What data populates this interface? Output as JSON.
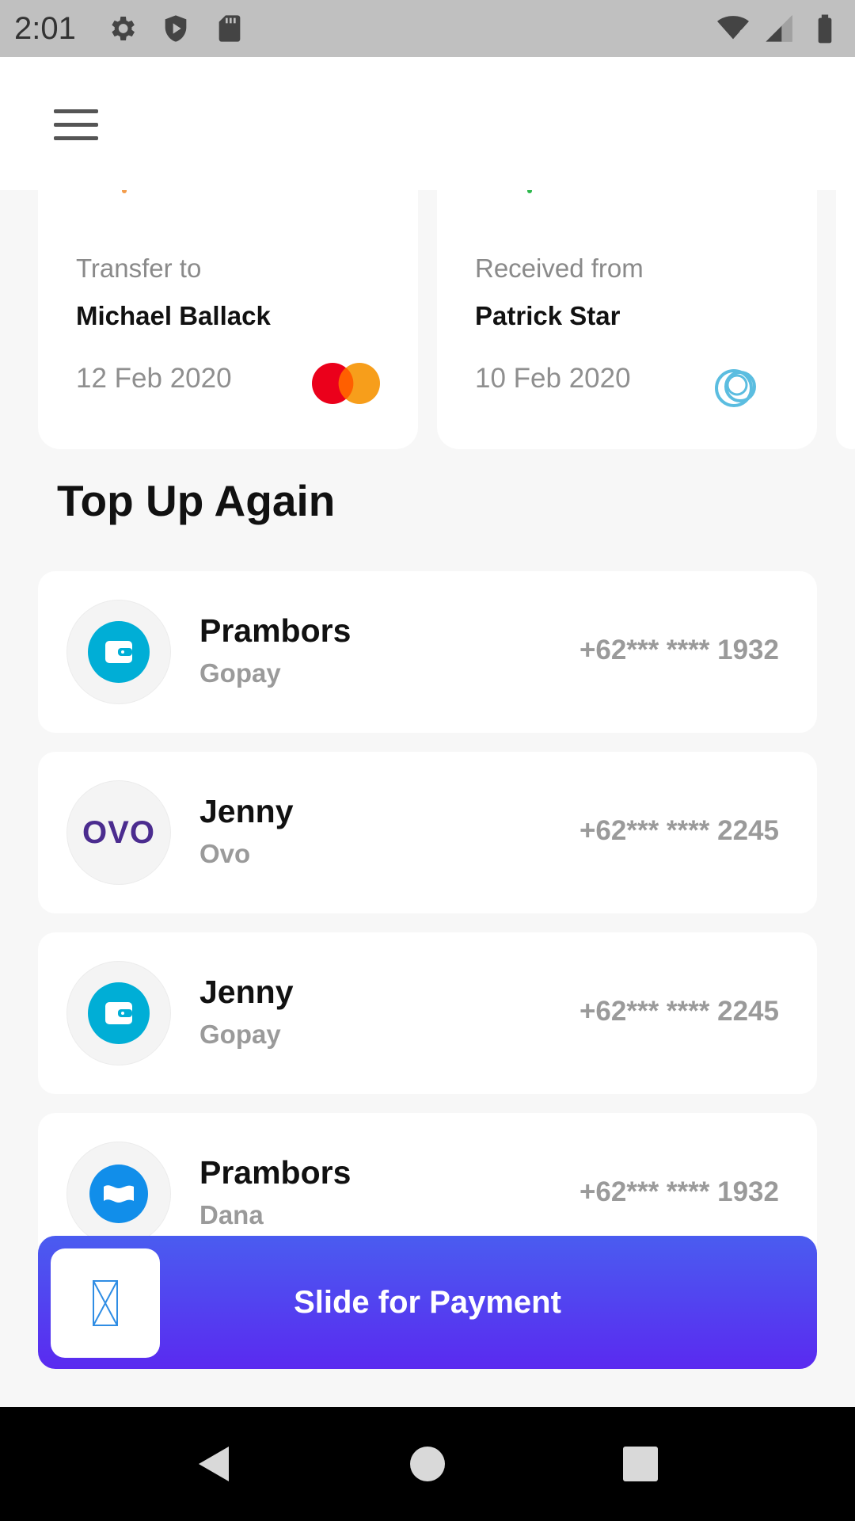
{
  "status_bar": {
    "time": "2:01",
    "left_icons": [
      "gear-icon",
      "shield-icon",
      "sd-card-icon"
    ],
    "right_icons": [
      "wifi-icon",
      "signal-icon",
      "battery-icon"
    ]
  },
  "app_bar": {
    "menu_icon": "hamburger-menu-icon"
  },
  "transactions": [
    {
      "label": "Transfer to",
      "name": "Michael Ballack",
      "date": "12 Feb 2020",
      "logo": "mastercard-logo",
      "dot_color": "#f39c4b"
    },
    {
      "label": "Received from",
      "name": "Patrick Star",
      "date": "10 Feb 2020",
      "logo": "rings-logo",
      "dot_color": "#2db84d"
    }
  ],
  "section_title": "Top Up Again",
  "topups": [
    {
      "name": "Prambors",
      "provider": "Gopay",
      "phone": "+62*** **** 1932",
      "icon": "gopay-wallet-icon"
    },
    {
      "name": "Jenny",
      "provider": "Ovo",
      "phone": "+62*** **** 2245",
      "icon": "ovo-logo",
      "logo_text": "OVO"
    },
    {
      "name": "Jenny",
      "provider": "Gopay",
      "phone": "+62*** **** 2245",
      "icon": "gopay-wallet-icon"
    },
    {
      "name": "Prambors",
      "provider": "Dana",
      "phone": "+62*** **** 1932",
      "icon": "dana-icon"
    }
  ],
  "slide_button": {
    "label": "Slide for Payment",
    "handle_icon": "slide-handle-icon"
  },
  "colors": {
    "accent_start": "#4a5cf0",
    "accent_end": "#5a2af0",
    "gopay_blue": "#00aed6",
    "dana_blue": "#118eea",
    "ovo_purple": "#4b2c8f"
  },
  "nav_bar": {
    "back": "back-icon",
    "home": "home-icon",
    "recents": "recents-icon"
  }
}
